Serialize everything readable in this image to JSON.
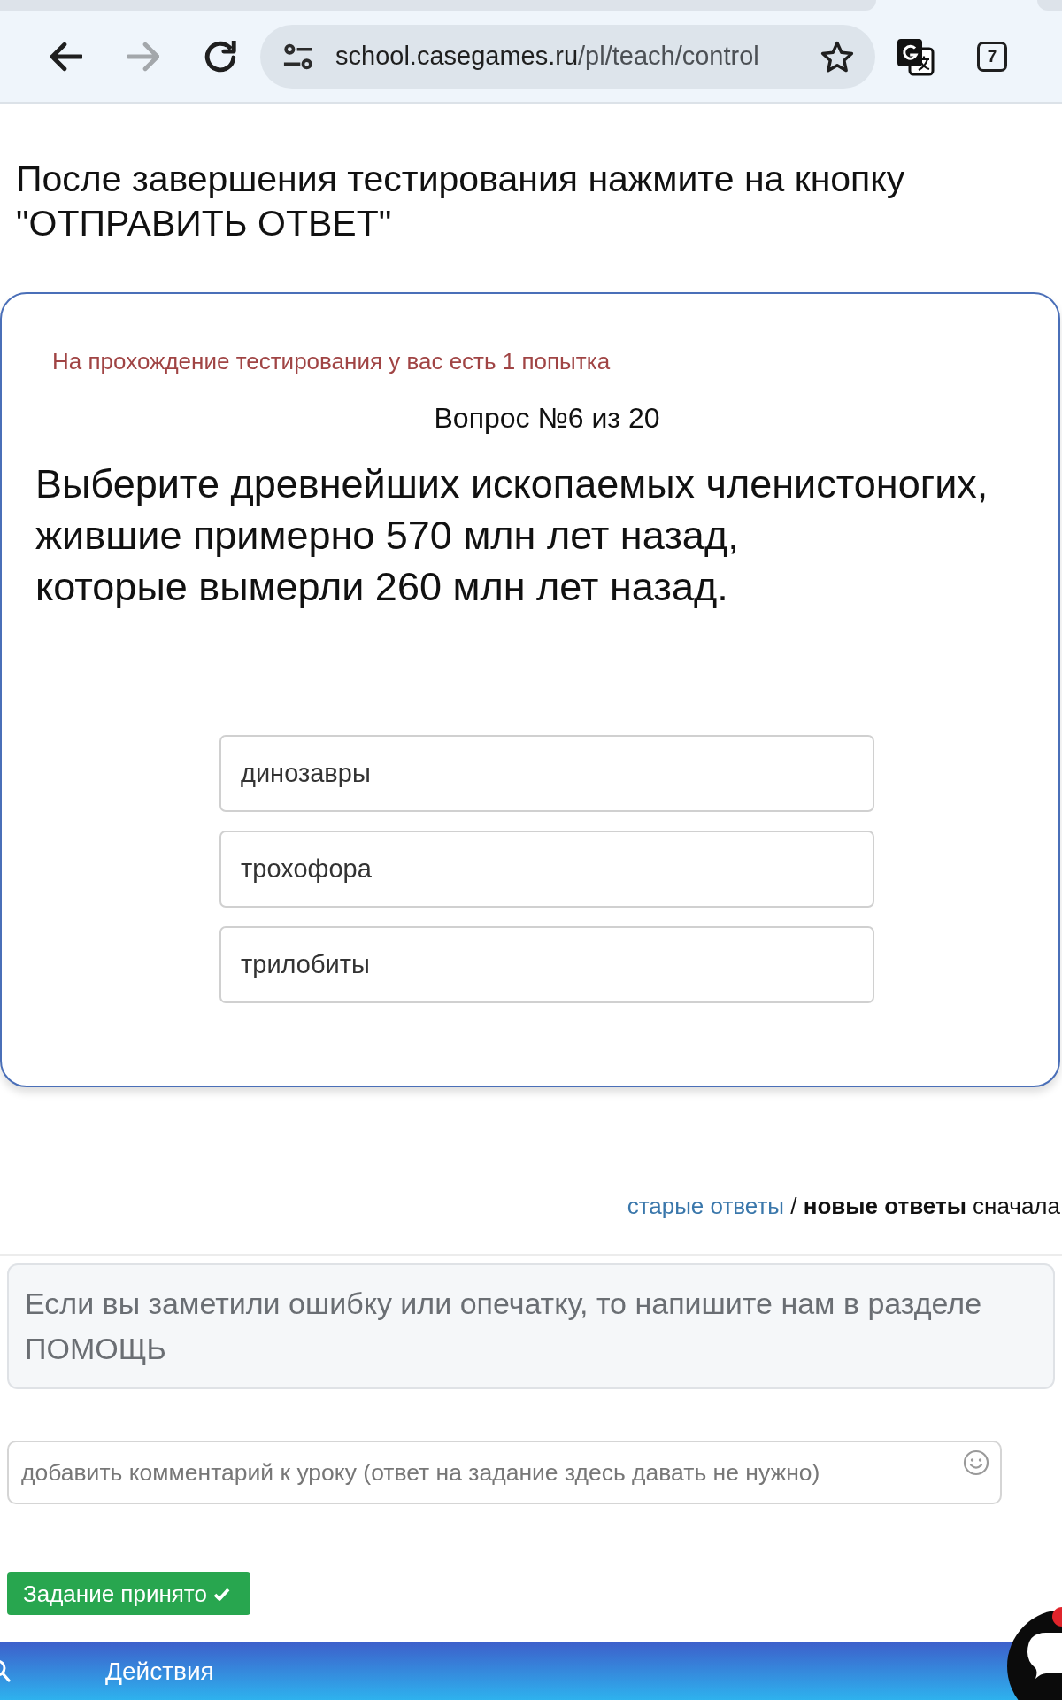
{
  "browser": {
    "nav_buttons": [
      {
        "kind": "back",
        "disabled": false
      },
      {
        "kind": "forward",
        "disabled": true
      },
      {
        "kind": "reload",
        "disabled": false
      }
    ],
    "address": {
      "host": "school.casegames.ru",
      "path": "/pl/teach/control"
    },
    "bookmarked": false,
    "tab_count": "7"
  },
  "instruction": "После завершения тестирования нажмите на кнопку \"ОТПРАВИТЬ ОТВЕТ\"",
  "quiz": {
    "attempts_notice": "На прохождение тестирования у вас есть 1 попытка",
    "counter": "Вопрос №6 из 20",
    "question": "Выберите древнейших ископаемых членистоногих,\nжившие примерно 570 млн лет назад,\nкоторые вымерли 260 млн лет назад.",
    "options": [
      {
        "label": "динозавры",
        "selected": false
      },
      {
        "label": "трохофора",
        "selected": false
      },
      {
        "label": "трилобиты",
        "selected": false
      }
    ]
  },
  "answers_sort": {
    "options": [
      {
        "label": "старые ответы",
        "selected": false
      },
      {
        "label": "новые ответы",
        "selected": true
      }
    ],
    "separator": "/",
    "suffix": "сначала"
  },
  "feedback_notice": "Если вы заметили ошибку или опечатку, то напишите нам в разделе ПОМОЩЬ",
  "comment": {
    "placeholder": "добавить комментарий к уроку (ответ на задание здесь давать не нужно)"
  },
  "status_button": {
    "label": "Задание принято"
  },
  "bottom_bar": {
    "label": "Действия"
  },
  "chat": {
    "unread": true
  }
}
